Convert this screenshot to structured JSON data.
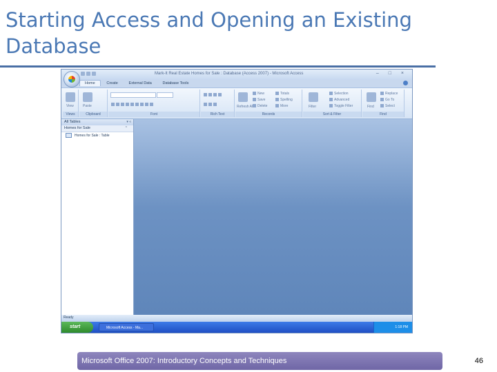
{
  "slide": {
    "title": "Starting Access and Opening an Existing Database",
    "footer": "Microsoft Office 2007: Introductory Concepts and Techniques",
    "page_number": "46"
  },
  "window": {
    "title": "Mark-It Real Estate Homes for Sale : Database (Access 2007) - Microsoft Access",
    "controls": "– □ ×"
  },
  "ribbon": {
    "tabs": [
      "Home",
      "Create",
      "External Data",
      "Database Tools"
    ],
    "groups": [
      "Views",
      "Clipboard",
      "Font",
      "Rich Text",
      "Records",
      "Sort & Filter",
      "Find"
    ],
    "views_label": "View",
    "paste_label": "Paste",
    "records_items": [
      "New",
      "Save",
      "Delete",
      "Totals",
      "Spelling",
      "More"
    ],
    "refresh_label": "Refresh All",
    "filter_label": "Filter",
    "sort_items": [
      "Selection",
      "Advanced",
      "Toggle Filter"
    ],
    "find_label": "Find",
    "find_items": [
      "Replace",
      "Go To",
      "Select"
    ]
  },
  "nav_pane": {
    "header": "All Tables",
    "group": "Homes for Sale",
    "item": "Homes for Sale : Table"
  },
  "status": {
    "text": "Ready"
  },
  "taskbar": {
    "start": "start",
    "item": "Microsoft Access - Ma...",
    "clock": "1:18 PM"
  }
}
